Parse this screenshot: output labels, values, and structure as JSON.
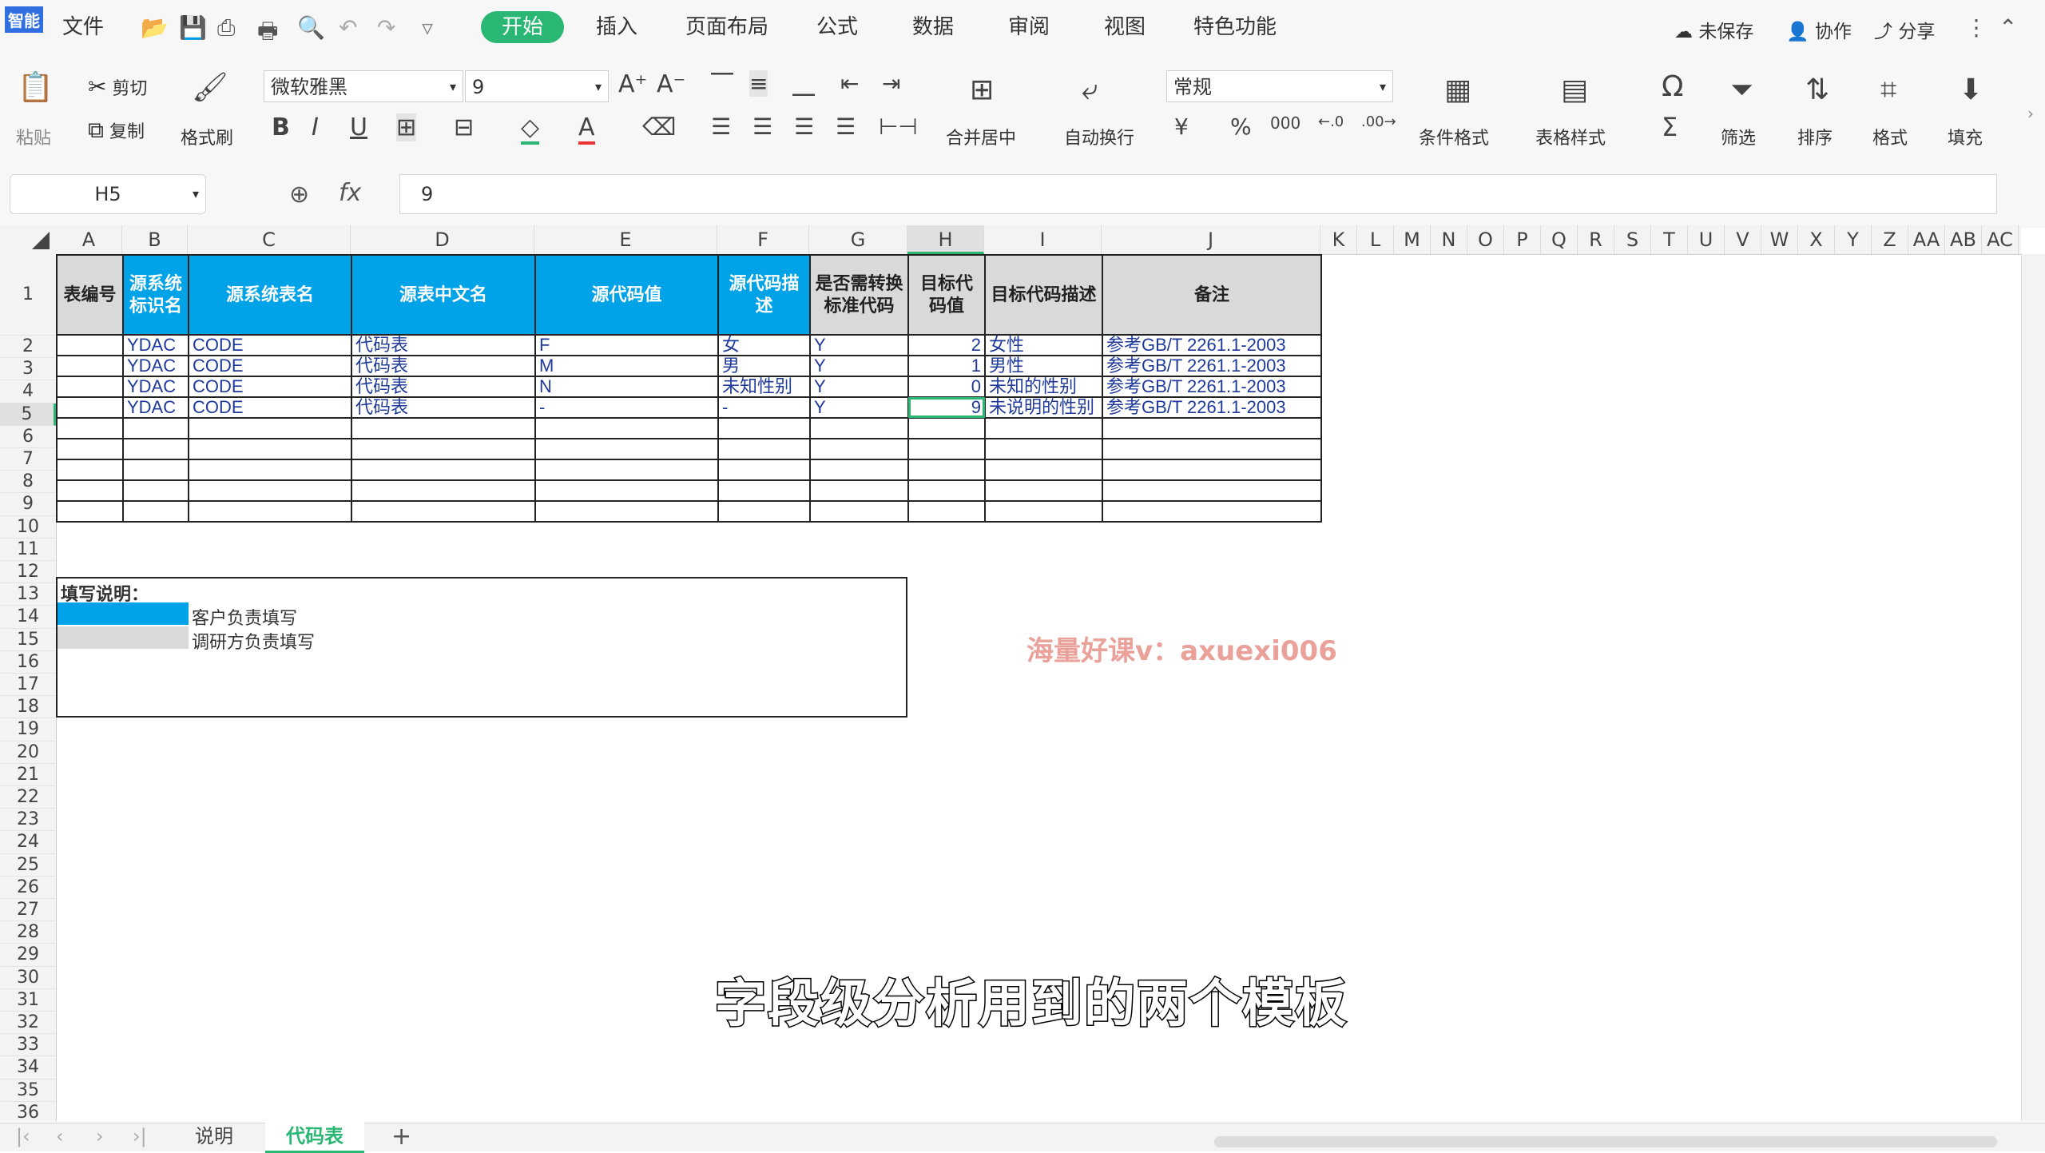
{
  "app": {
    "badge": "智能",
    "file": "文件"
  },
  "menu": [
    "开始",
    "插入",
    "页面布局",
    "公式",
    "数据",
    "审阅",
    "视图",
    "特色功能"
  ],
  "topright": {
    "unsaved": "未保存",
    "collab": "协作",
    "share": "分享"
  },
  "ribbon": {
    "paste": "粘贴",
    "cut": "剪切",
    "copy": "复制",
    "format_painter": "格式刷",
    "font": "微软雅黑",
    "size": "9",
    "merge": "合并居中",
    "wrap": "自动换行",
    "numfmt": "常规",
    "cond_format": "条件格式",
    "table_style": "表格样式",
    "filter": "筛选",
    "sort": "排序",
    "format": "格式",
    "fill": "填充"
  },
  "formula": {
    "cell": "H5",
    "fx": "fx",
    "value": "9"
  },
  "columns": [
    "A",
    "B",
    "C",
    "D",
    "E",
    "F",
    "G",
    "H",
    "I",
    "J",
    "K",
    "L",
    "M",
    "N",
    "O",
    "P",
    "Q",
    "R",
    "S",
    "T",
    "U",
    "V",
    "W",
    "X",
    "Y",
    "Z",
    "AA",
    "AB",
    "AC"
  ],
  "rows": [
    "1",
    "2",
    "3",
    "4",
    "5",
    "6",
    "7",
    "8",
    "9",
    "10",
    "11",
    "12",
    "13",
    "14",
    "15",
    "16",
    "17",
    "18",
    "19",
    "20",
    "21",
    "22",
    "23",
    "24",
    "25",
    "26",
    "27",
    "28",
    "29",
    "30",
    "31",
    "32",
    "33",
    "34",
    "35",
    "36"
  ],
  "table": {
    "headers": [
      "表编号",
      "源系统标识名",
      "源系统表名",
      "源表中文名",
      "源代码值",
      "源代码描述",
      "是否需转换标准代码",
      "目标代码值",
      "目标代码描述",
      "备注"
    ],
    "data": [
      [
        "",
        "YDAC",
        "CODE",
        "代码表",
        "F",
        "女",
        "Y",
        "2",
        "女性",
        "参考GB/T 2261.1-2003"
      ],
      [
        "",
        "YDAC",
        "CODE",
        "代码表",
        "M",
        "男",
        "Y",
        "1",
        "男性",
        "参考GB/T 2261.1-2003"
      ],
      [
        "",
        "YDAC",
        "CODE",
        "代码表",
        "N",
        "未知性别",
        "Y",
        "0",
        "未知的性别",
        "参考GB/T 2261.1-2003"
      ],
      [
        "",
        "YDAC",
        "CODE",
        "代码表",
        "-",
        "-",
        "Y",
        "9",
        "未说明的性别",
        "参考GB/T 2261.1-2003"
      ]
    ]
  },
  "notes": {
    "title": "填写说明：",
    "customer": "客户负责填写",
    "research": "调研方负责填写"
  },
  "watermark": "海量好课v：axuexi006",
  "subtitle": "字段级分析用到的两个模板",
  "tabs": [
    "说明",
    "代码表"
  ],
  "colors": {
    "accent": "#2ab673",
    "header_blue": "#00a2e8",
    "header_gray": "#d9d9d9"
  }
}
